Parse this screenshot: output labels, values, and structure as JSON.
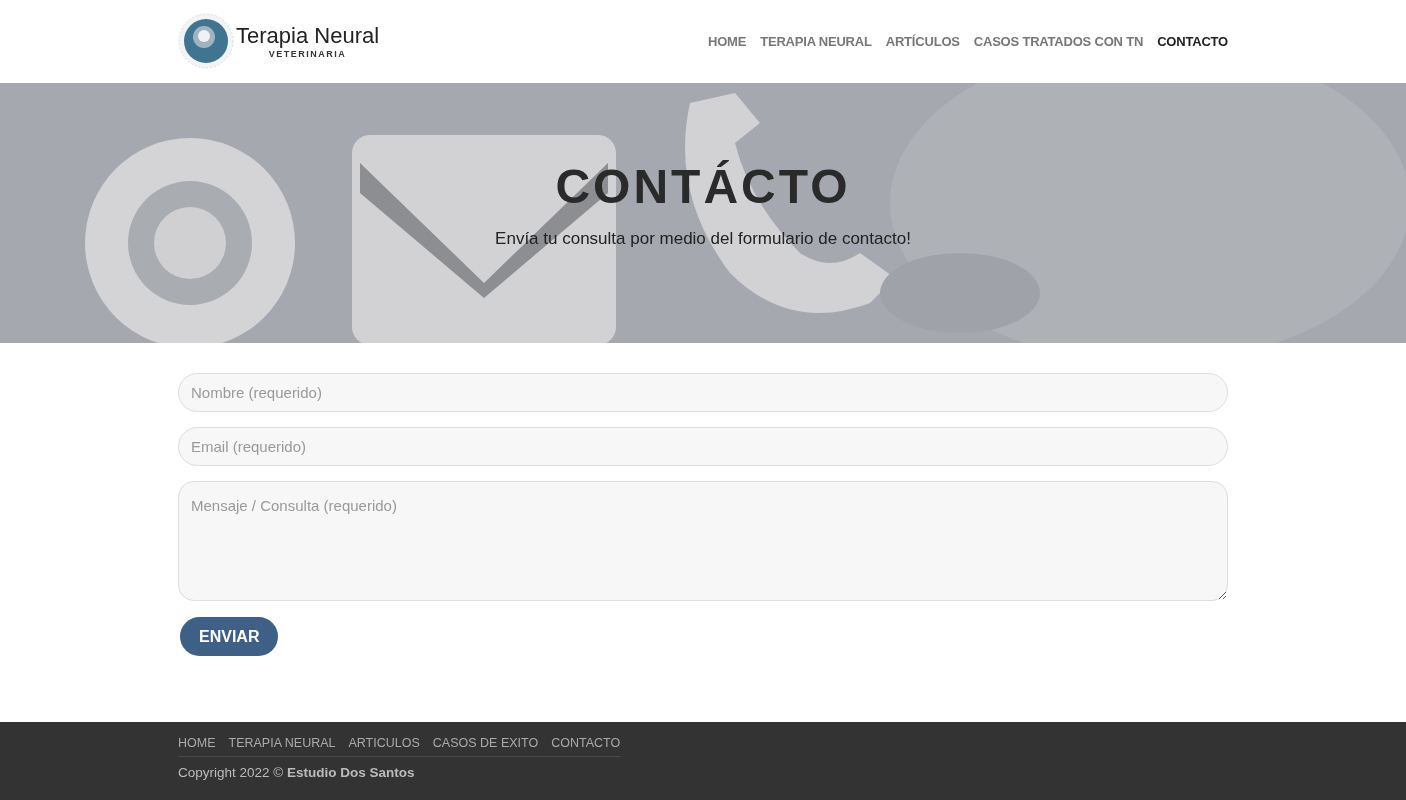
{
  "header": {
    "logo": {
      "title": "Terapia Neural",
      "subtitle": "VETERINARIA"
    },
    "nav": [
      {
        "label": "HOME",
        "selected": false
      },
      {
        "label": "TERAPIA NEURAL",
        "selected": false
      },
      {
        "label": "ARTÍCULOS",
        "selected": false
      },
      {
        "label": "CASOS TRATADOS CON TN",
        "selected": false
      },
      {
        "label": "CONTACTO",
        "selected": true
      }
    ]
  },
  "hero": {
    "title": "CONTÁCTO",
    "subtitle": "Envía tu consulta por medio del formulario de contacto!"
  },
  "form": {
    "fields": [
      {
        "kind": "input",
        "placeholder": "Nombre (requerido)"
      },
      {
        "kind": "input",
        "placeholder": "Email (requerido)"
      },
      {
        "kind": "textarea",
        "placeholder": "Mensaje / Consulta (requerido)"
      }
    ],
    "submit": "ENVIAR"
  },
  "footer": {
    "links": [
      "HOME",
      "TERAPIA NEURAL",
      "ARTICULOS",
      "CASOS DE EXITO",
      "CONTACTO"
    ],
    "copyright": "Copyright 2022 © **Estudio Dos Santos**"
  }
}
